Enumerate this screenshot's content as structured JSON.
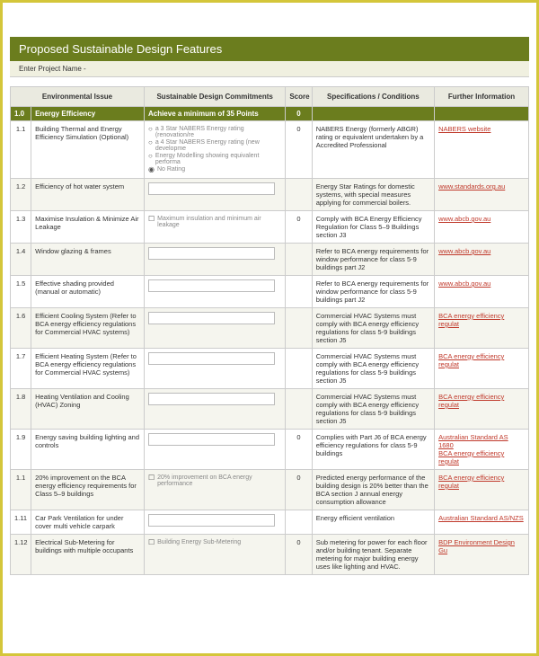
{
  "title": "Proposed Sustainable Design Features",
  "project_label": "Enter Project Name -",
  "headers": {
    "issue": "Environmental Issue",
    "commit": "Sustainable Design Commitments",
    "score": "Score",
    "spec": "Specifications / Conditions",
    "info": "Further Information"
  },
  "section": {
    "num": "1.0",
    "title": "Energy Efficiency",
    "target": "Achieve a minimum of 35 Points",
    "score": "0"
  },
  "rows": [
    {
      "num": "1.1",
      "issue": "Building Thermal and Energy Efficiency Simulation (Optional)",
      "commit_type": "radio",
      "options": [
        {
          "sel": false,
          "label": "a 3 Star NABERS Energy rating (renovation/re"
        },
        {
          "sel": false,
          "label": "a 4 Star NABERS Energy rating (new developme"
        },
        {
          "sel": false,
          "label": "Energy Modelling showing equivalent performa"
        },
        {
          "sel": true,
          "label": "No Rating"
        }
      ],
      "score": "0",
      "spec": "NABERS Energy (formerly ABGR) rating or equivalent undertaken by a Accredited Professional",
      "links": [
        "NABERS website"
      ]
    },
    {
      "num": "1.2",
      "issue": "Efficiency of hot water system",
      "commit_type": "input",
      "score": "",
      "spec": "Energy Star Ratings for domestic systems, with special measures applying for commercial boilers.",
      "links": [
        "www.standards.org.au"
      ]
    },
    {
      "num": "1.3",
      "issue": "Maximise Insulation & Minimize Air Leakage",
      "commit_type": "check",
      "check_label": "Maximum insulation and minimum air leakage",
      "score": "0",
      "spec": "Comply with BCA Energy Efficiency Regulation for Class 5–9 Buildings section J3",
      "links": [
        "www.abcb.gov.au"
      ]
    },
    {
      "num": "1.4",
      "issue": "Window glazing & frames",
      "commit_type": "input",
      "score": "",
      "spec": "Refer to BCA energy requirements for window performance for class 5-9 buildings part J2",
      "links": [
        "www.abcb.gov.au"
      ]
    },
    {
      "num": "1.5",
      "issue": "Effective shading provided (manual or automatic)",
      "commit_type": "input",
      "score": "",
      "spec": "Refer to BCA energy requirements for window performance for class 5-9 buildings part J2",
      "links": [
        "www.abcb.gov.au"
      ]
    },
    {
      "num": "1.6",
      "issue": "Efficient Cooling System (Refer to BCA energy efficiency regulations for Commercial HVAC systems)",
      "commit_type": "input",
      "score": "",
      "spec": "Commercial HVAC Systems must comply with BCA energy efficiency regulations for class 5-9 buildings section J5",
      "links": [
        "BCA energy efficiency regulat"
      ]
    },
    {
      "num": "1.7",
      "issue": "Efficient Heating System (Refer to BCA energy efficiency regulations for Commercial HVAC systems)",
      "commit_type": "input",
      "score": "",
      "spec": "Commercial HVAC Systems must comply with BCA energy efficiency regulations for class 5-9 buildings section J5",
      "links": [
        "BCA energy efficiency regulat"
      ]
    },
    {
      "num": "1.8",
      "issue": "Heating Ventilation and Cooling (HVAC) Zoning",
      "commit_type": "input",
      "score": "",
      "spec": "Commercial HVAC Systems must comply with BCA energy efficiency regulations for class 5-9 buildings section J5",
      "links": [
        "BCA energy efficiency regulat"
      ]
    },
    {
      "num": "1.9",
      "issue": "Energy saving building lighting and controls",
      "commit_type": "input",
      "score": "0",
      "spec": "Complies with Part J6 of BCA energy efficiency regulations for class 5-9 buildings",
      "links": [
        "Australian Standard AS 1680",
        "BCA energy efficiency regulat"
      ]
    },
    {
      "num": "1.1",
      "issue": "20% improvement on the BCA energy efficiency requirements for Class 5–9 buildings",
      "commit_type": "check",
      "check_label": "20% improvement on BCA energy performance",
      "score": "0",
      "spec": "Predicted energy performance of the building design is 20% better than the BCA section J annual energy consumption allowance",
      "links": [
        "BCA energy efficiency regulat"
      ]
    },
    {
      "num": "1.11",
      "issue": "Car Park Ventilation for under cover multi vehicle carpark",
      "commit_type": "input",
      "score": "",
      "spec": "Energy efficient ventilation",
      "links": [
        "Australian Standard AS/NZS"
      ]
    },
    {
      "num": "1.12",
      "issue": "Electrical Sub-Metering for buildings with multiple occupants",
      "commit_type": "check",
      "check_label": "Building Energy Sub-Metering",
      "score": "0",
      "spec": "Sub metering for power for each floor and/or building tenant. Separate metering for major building energy uses like lighting and HVAC.",
      "links": [
        "BDP Environment Design Gu"
      ]
    }
  ]
}
